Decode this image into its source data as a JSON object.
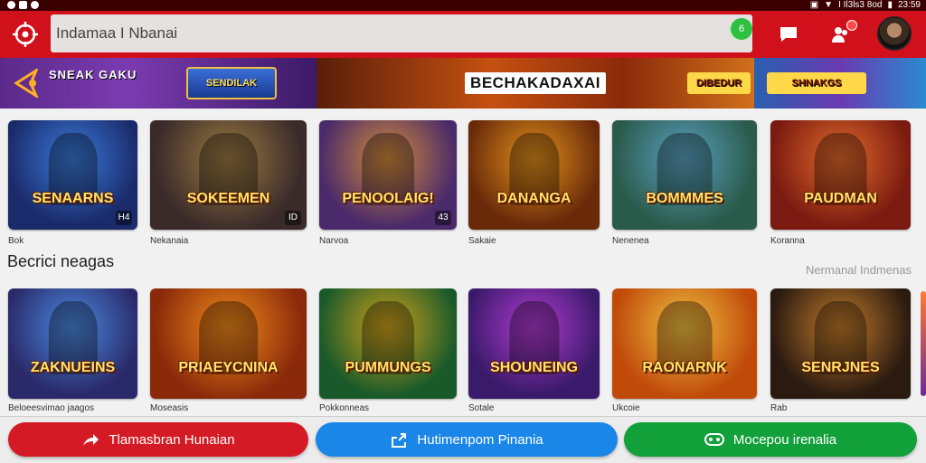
{
  "statusbar": {
    "time": "23:59",
    "right_text": "I Il3ls3 8od"
  },
  "search": {
    "value": "Indamaa I Nbanai",
    "badge": "6"
  },
  "banner": {
    "left_text": "SNEAK GAKU",
    "left_logo": "SENDILAK",
    "center_title": "BECHAKADAXAI",
    "center_badge": "DIBEDUR",
    "right_logo": "SHNAKGS"
  },
  "row1": [
    {
      "title": "SENAARNS",
      "corner": "H4",
      "label": "Bok",
      "bg": "#1a2a6a",
      "accent": "#3a7ad8"
    },
    {
      "title": "SOKEEMEN",
      "corner": "ID",
      "label": "Nekanaia",
      "bg": "#3a2a2a",
      "accent": "#9a7a40"
    },
    {
      "title": "PENOOLAIG!",
      "corner": "43",
      "label": "Narvoa",
      "bg": "#4a2a6a",
      "accent": "#d08a3a"
    },
    {
      "title": "DANANGA",
      "corner": "",
      "label": "Sakaie",
      "bg": "#6a2a0a",
      "accent": "#e0901a"
    },
    {
      "title": "BOMMMES",
      "corner": "",
      "label": "Nenenea",
      "bg": "#2a5a4a",
      "accent": "#5aa0c0"
    },
    {
      "title": "PAUDMAN",
      "corner": "",
      "label": "Koranna",
      "bg": "#7a1a10",
      "accent": "#e06a2a"
    }
  ],
  "section": {
    "title": "Becrici neagas",
    "link": "Nermanal Indmenas"
  },
  "row2": [
    {
      "title": "ZAKNUEINS",
      "corner": "",
      "label": "Beloeesvimao jaagos",
      "bg": "#2a2a6a",
      "accent": "#4a8ae0"
    },
    {
      "title": "PRIAEYCNINA",
      "corner": "",
      "label": "Moseasis",
      "bg": "#8a2a0a",
      "accent": "#f08a1a"
    },
    {
      "title": "PUMMUNGS",
      "corner": "",
      "label": "Pokkonneas",
      "bg": "#1a5a2a",
      "accent": "#d0a01a"
    },
    {
      "title": "SHOUNEING",
      "corner": "",
      "label": "Sotale",
      "bg": "#3a1a6a",
      "accent": "#b03ad0"
    },
    {
      "title": "RAONARNK",
      "corner": "",
      "label": "Ukcoie",
      "bg": "#c04a0a",
      "accent": "#f0c040"
    },
    {
      "title": "SENRJNES",
      "corner": "",
      "label": "Rab",
      "bg": "#2a1a10",
      "accent": "#c07a2a"
    }
  ],
  "buttons": [
    {
      "label": "Tlamasbran Hunaian",
      "icon": "share-icon"
    },
    {
      "label": "Hutimenpom Pinania",
      "icon": "export-icon"
    },
    {
      "label": "Mocepou irenalia",
      "icon": "controller-icon"
    }
  ]
}
